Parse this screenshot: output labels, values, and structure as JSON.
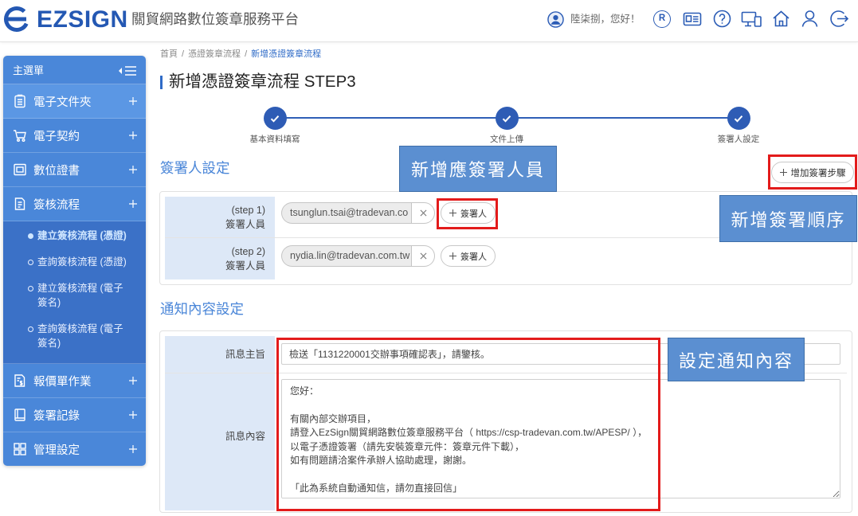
{
  "header": {
    "brand": "EZSIGN",
    "platform_name": "關貿網路數位簽章服務平台",
    "greeting": "陸柒捌，您好！",
    "role_badge": "R",
    "icons": [
      "logo-icon",
      "user-circle-icon",
      "role-r-icon",
      "id-card-icon",
      "help-icon",
      "devices-icon",
      "home-icon",
      "user-icon",
      "logout-icon"
    ]
  },
  "sidebar": {
    "title": "主選單",
    "items": [
      {
        "label": "電子文件夾",
        "icon": "document-list-icon"
      },
      {
        "label": "電子契約",
        "icon": "cart-icon"
      },
      {
        "label": "數位證書",
        "icon": "certificate-icon"
      },
      {
        "label": "簽核流程",
        "icon": "document-edit-icon",
        "expanded": true,
        "sub_items": [
          {
            "label": "建立簽核流程 (憑證)",
            "active": true
          },
          {
            "label": "查詢簽核流程 (憑證)",
            "active": false
          },
          {
            "label": "建立簽核流程 (電子簽名)",
            "active": false
          },
          {
            "label": "查詢簽核流程 (電子簽名)",
            "active": false
          }
        ]
      },
      {
        "label": "報價單作業",
        "icon": "invoice-dollar-icon"
      },
      {
        "label": "簽署記錄",
        "icon": "notebook-icon"
      },
      {
        "label": "管理設定",
        "icon": "grid-icon"
      }
    ]
  },
  "breadcrumb": {
    "items": [
      "首頁",
      "憑證簽章流程",
      "新增憑證簽章流程"
    ],
    "separator": "/"
  },
  "page_title": "新增憑證簽章流程 STEP3",
  "stepper": {
    "steps": [
      {
        "label": "基本資料填寫",
        "done": true
      },
      {
        "label": "文件上傳",
        "done": true
      },
      {
        "label": "簽署人設定",
        "done": true
      }
    ]
  },
  "signer_section": {
    "title": "簽署人設定",
    "add_step_label": "增加簽署步驟",
    "rows": [
      {
        "step": "(step 1)",
        "role": "簽署人員",
        "signers": [
          "tsunglun.tsai@tradevan.co"
        ],
        "add_signer_label": "簽署人"
      },
      {
        "step": "(step 2)",
        "role": "簽署人員",
        "signers": [
          "nydia.lin@tradevan.com.tw"
        ],
        "add_signer_label": "簽署人"
      }
    ]
  },
  "notify_section": {
    "title": "通知內容設定",
    "subject_label": "訊息主旨",
    "subject_value": "檢送「1131220001交辦事項確認表」，請鑒核。",
    "body_label": "訊息內容",
    "body_value": "您好：\n\n有關內部交辦項目，\n請登入EzSign關貿網路數位簽章服務平台（ https://csp-tradevan.com.tw/APESP/ ），\n以電子憑證簽署（請先安裝簽章元件：簽章元件下載），\n如有問題請洽案件承辦人協助處理，謝謝。\n\n「此為系統自動通知信，請勿直接回信」"
  },
  "annotations": {
    "callouts": [
      "新增應簽署人員",
      "新增簽署順序",
      "設定通知內容"
    ],
    "highlight_color": "#e31b1b",
    "callout_color": "#5b8fd1"
  },
  "colors": {
    "brand": "#2458b3",
    "sidebar": "#4a87d9",
    "sidebar_submenu": "#3b71c7",
    "stepper": "#2e5cb5",
    "section_title": "#4a86d8",
    "label_cell": "#dde8f7"
  }
}
